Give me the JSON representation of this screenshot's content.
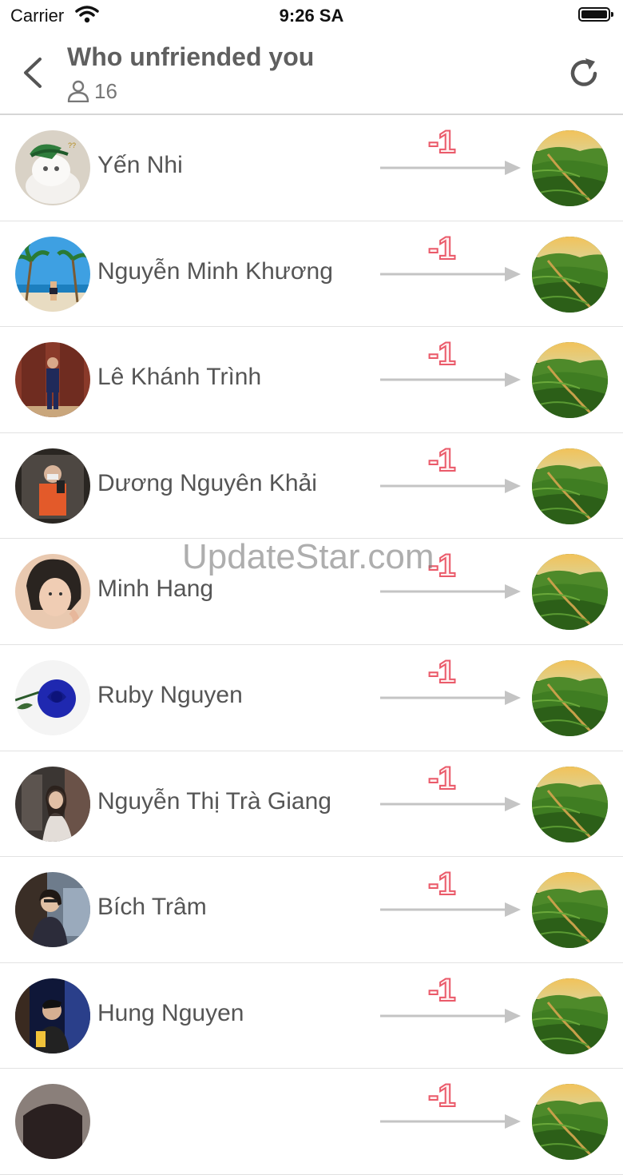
{
  "status_bar": {
    "carrier": "Carrier",
    "time": "9:26 SA"
  },
  "header": {
    "title": "Who unfriended you",
    "count": "16"
  },
  "watermark": "UpdateStar.com",
  "change_label": "-1",
  "friends": [
    {
      "name": "Yến Nhi",
      "avatar": "cat-avatar"
    },
    {
      "name": "Nguyễn Minh Khương",
      "avatar": "beach-avatar"
    },
    {
      "name": "Lê Khánh Trình",
      "avatar": "suit-avatar"
    },
    {
      "name": "Dương Nguyên Khải",
      "avatar": "mirror-selfie-avatar"
    },
    {
      "name": "Minh Hang",
      "avatar": "girl-portrait-avatar"
    },
    {
      "name": "Ruby Nguyen",
      "avatar": "blue-rose-avatar"
    },
    {
      "name": "Nguyễn Thị Trà Giang",
      "avatar": "girl-selfie-avatar"
    },
    {
      "name": "Bích Trâm",
      "avatar": "girl-sitting-avatar"
    },
    {
      "name": "Hung Nguyen",
      "avatar": "boy-bar-avatar"
    },
    {
      "name": "",
      "avatar": "partial-avatar"
    }
  ],
  "colors": {
    "accent_red": "#ea5a6a",
    "arrow_gray": "#c4c4c4",
    "divider": "#e2e2e2"
  }
}
